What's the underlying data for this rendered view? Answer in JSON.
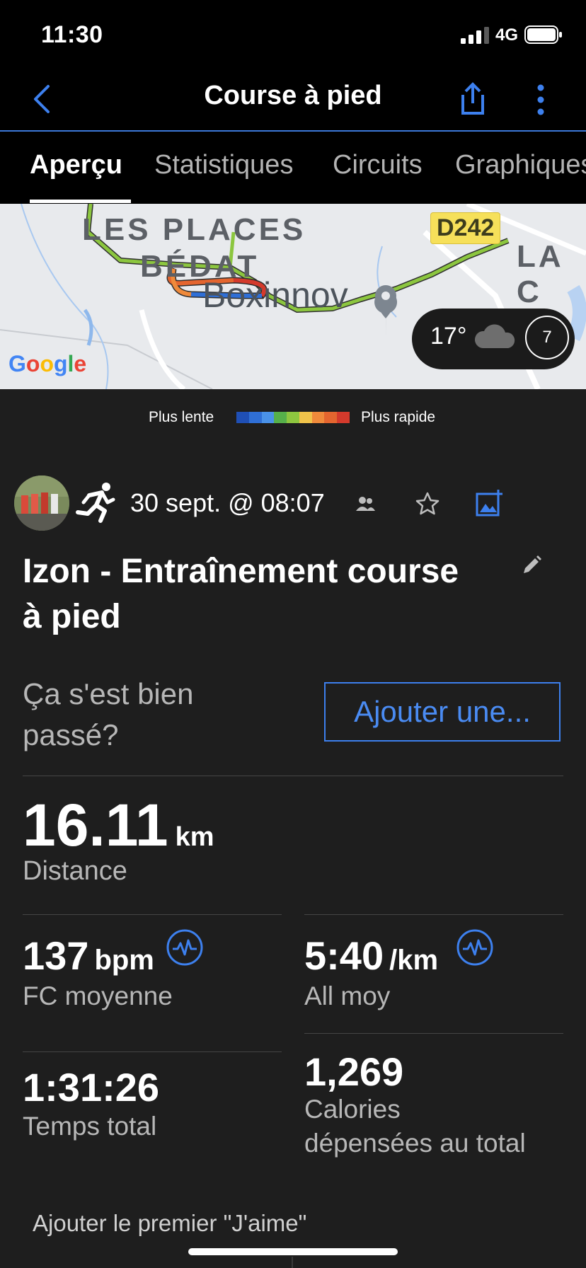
{
  "status_bar": {
    "time": "11:30",
    "network": "4G"
  },
  "nav": {
    "title": "Course à pied"
  },
  "tabs": [
    {
      "label": "Aperçu"
    },
    {
      "label": "Statistiques"
    },
    {
      "label": "Circuits"
    },
    {
      "label": "Graphiques"
    }
  ],
  "map": {
    "labels": [
      "LES PLACES",
      "BÉDAT",
      "Boxinnov",
      "LA C"
    ],
    "road_badge": "D242",
    "attribution": "Google",
    "weather": {
      "temperature": "17°",
      "wind": "7",
      "condition_icon": "cloud-icon"
    }
  },
  "legend": {
    "slow": "Plus lente",
    "fast": "Plus rapide",
    "colors": [
      "#1f4fb5",
      "#2f6fd6",
      "#4a92e8",
      "#56b04a",
      "#8ec63f",
      "#f0c34a",
      "#ef8a3b",
      "#e4652f",
      "#d43a2c"
    ]
  },
  "activity": {
    "date": "30 sept. @ 08:07",
    "title": "Izon - Entraînement course à pied",
    "feel_question": "Ça s'est bien passé?",
    "add_button": "Ajouter une..."
  },
  "stats": {
    "distance": {
      "value": "16.11",
      "unit": "km",
      "label": "Distance"
    },
    "heart_rate": {
      "value": "137",
      "unit": "bpm",
      "label": "FC moyenne"
    },
    "pace": {
      "value": "5:40",
      "unit": "/km",
      "label": "All moy"
    },
    "time": {
      "value": "1:31:26",
      "label": "Temps total"
    },
    "calories": {
      "value": "1,269",
      "label_line1": "Calories",
      "label_line2": "dépensées au total"
    }
  },
  "social": {
    "like_prompt": "Ajouter le premier \"J'aime\""
  },
  "colors": {
    "accent": "#3d80ee",
    "background": "#1e1e1e"
  }
}
